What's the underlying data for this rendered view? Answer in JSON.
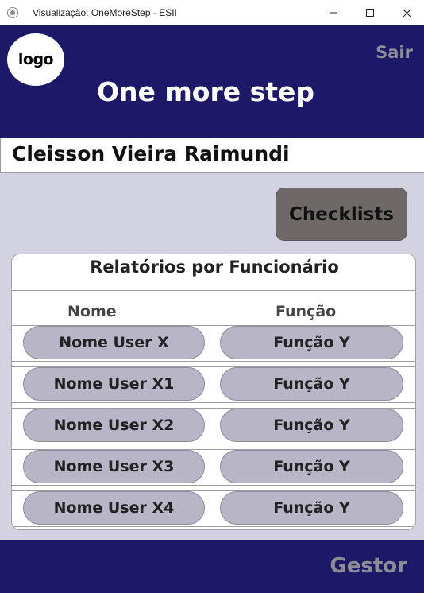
{
  "window": {
    "title": "Visualização: OneMoreStep - ESII"
  },
  "header": {
    "logo_text": "logo",
    "logout_label": "Sair",
    "app_title": "One more step"
  },
  "user": {
    "full_name": "Cleisson Vieira Raimundi"
  },
  "actions": {
    "checklists_label": "Checklists"
  },
  "report": {
    "title": "Relatórios por Funcionário",
    "columns": {
      "name": "Nome",
      "role": "Função"
    },
    "rows": [
      {
        "name": "Nome User X",
        "role": "Função Y"
      },
      {
        "name": "Nome User X1",
        "role": "Função Y"
      },
      {
        "name": "Nome User X2",
        "role": "Função Y"
      },
      {
        "name": "Nome User X3",
        "role": "Função Y"
      },
      {
        "name": "Nome User X4",
        "role": "Função Y"
      }
    ]
  },
  "footer": {
    "role_label": "Gestor"
  },
  "colors": {
    "header_bg": "#1e1869",
    "page_bg": "#d2d2e0",
    "pill_bg": "#b8b6c6",
    "button_bg": "#6e6868",
    "muted_text": "#8e8c95"
  }
}
